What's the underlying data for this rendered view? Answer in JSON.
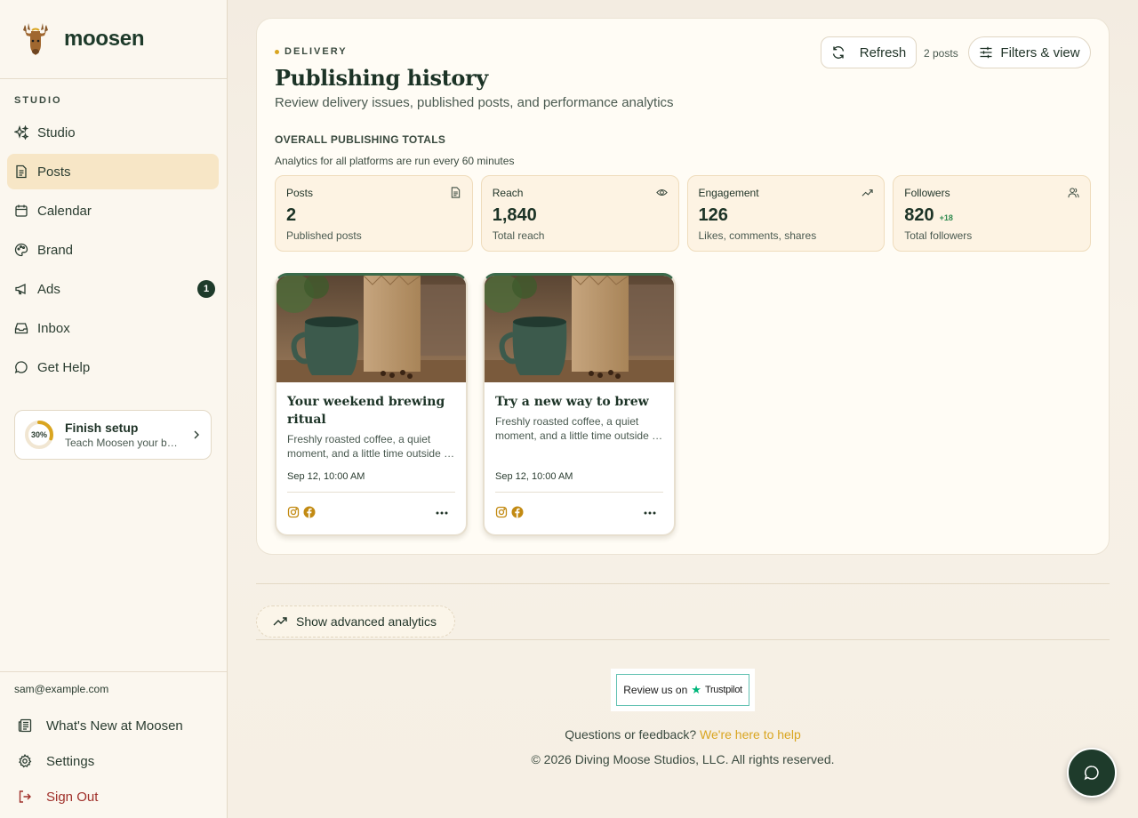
{
  "app": {
    "name": "moosen"
  },
  "sidebar": {
    "section_label": "STUDIO",
    "items": [
      {
        "label": "Studio",
        "icon": "sparkles-icon",
        "active": false
      },
      {
        "label": "Posts",
        "icon": "document-icon",
        "active": true
      },
      {
        "label": "Calendar",
        "icon": "calendar-icon",
        "active": false
      },
      {
        "label": "Brand",
        "icon": "palette-icon",
        "active": false
      },
      {
        "label": "Ads",
        "icon": "megaphone-icon",
        "active": false,
        "badge": "1"
      },
      {
        "label": "Inbox",
        "icon": "inbox-icon",
        "active": false
      },
      {
        "label": "Get Help",
        "icon": "chat-bubble-icon",
        "active": false
      }
    ],
    "setup": {
      "title": "Finish setup",
      "subtitle": "Teach Moosen your brand",
      "progress_label": "30%",
      "progress": 0.3
    },
    "user_email": "sam@example.com",
    "bottom_items": [
      {
        "label": "What's New at Moosen",
        "icon": "newspaper-icon"
      },
      {
        "label": "Settings",
        "icon": "gear-icon"
      },
      {
        "label": "Sign Out",
        "icon": "sign-out-icon"
      }
    ]
  },
  "header": {
    "eyebrow": "DELIVERY",
    "title": "Publishing history",
    "subtitle": "Review delivery issues, published posts, and performance analytics",
    "refresh_label": "Refresh",
    "post_count": "2 posts",
    "filters_label": "Filters & view"
  },
  "totals": {
    "title": "OVERALL PUBLISHING TOTALS",
    "note": "Analytics for all platforms are run every 60 minutes",
    "stats": [
      {
        "label": "Posts",
        "value": "2",
        "sub": "Published posts",
        "icon": "document-icon"
      },
      {
        "label": "Reach",
        "value": "1,840",
        "sub": "Total reach",
        "icon": "eye-icon"
      },
      {
        "label": "Engagement",
        "value": "126",
        "sub": "Likes, comments, shares",
        "icon": "trending-up-icon"
      },
      {
        "label": "Followers",
        "value": "820",
        "delta": "+18",
        "sub": "Total followers",
        "icon": "users-icon"
      }
    ]
  },
  "posts": [
    {
      "title": "Your weekend brewing ritual",
      "text": "Freshly roasted coffee, a quiet moment, and a little time outside to enjoy it.",
      "date": "Sep 12, 10:00 AM",
      "platforms": [
        "instagram-icon",
        "facebook-icon"
      ]
    },
    {
      "title": "Try a new way to brew",
      "text": "Freshly roasted coffee, a quiet moment, and a little time outside to enjoy it.",
      "date": "Sep 12, 10:00 AM",
      "platforms": [
        "instagram-icon",
        "facebook-icon"
      ]
    }
  ],
  "advanced_analytics_label": "Show advanced analytics",
  "trustpilot": {
    "prefix": "Review us on",
    "brand": "Trustpilot"
  },
  "footer": {
    "question": "Questions or feedback?",
    "help_link": "We're here to help",
    "copyright": "© 2026 Diving Moose Studios, LLC. All rights reserved."
  },
  "colors": {
    "accent": "#1e3b2b",
    "highlight": "#d9a520",
    "active_nav": "#f7e6c6",
    "stat_card": "#fdf3e3",
    "danger": "#a0302a"
  }
}
